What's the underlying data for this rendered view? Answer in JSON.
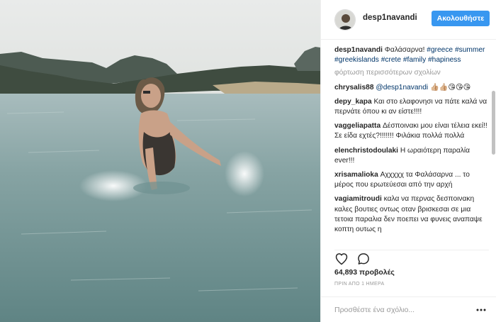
{
  "header": {
    "username": "desp1navandi",
    "follow_label": "Ακολουθήστε"
  },
  "caption": {
    "username": "desp1navandi",
    "text": "Φαλάσαρνα!",
    "hashtags": [
      "#greece",
      "#summer",
      "#greekislands",
      "#crete",
      "#family",
      "#hapiness"
    ]
  },
  "load_more_label": "φόρτωση περισσότερων σχολίων",
  "comments": [
    {
      "user": "chrysalis88",
      "mention": "@desp1navandi",
      "text": "👍🏼👍🏼😘😘😘"
    },
    {
      "user": "depy_kapa",
      "mention": "",
      "text": "Και στο ελαφονησι να πάτε καλά να περνάτε όπου κι αν είστε!!!!"
    },
    {
      "user": "vaggeliapatta",
      "mention": "",
      "text": "Δέσποινακι μου είναι τέλεια εκεί!! Σε είδα εχτές?!!!!!!! Φιλάκια πολλά πολλά"
    },
    {
      "user": "elenchristodoulaki",
      "mention": "",
      "text": "Η ωραιότερη παραλία ever!!!"
    },
    {
      "user": "xrisamalioka",
      "mention": "",
      "text": "Αχχχχχ τα Φαλάσαρνα ... το μέρος που ερωτεύεσαι από την αρχή"
    },
    {
      "user": "vagiamitroudi",
      "mention": "",
      "text": "καλα να περνας δεσποινακη καλες βουτιες οντως οταν βρισκεσαι σε μια τετοια παραλια δεν ποεπει να φυνεις αναπαψε κοπτη ουτως η"
    }
  ],
  "likes_text": "64,893 προβολές",
  "time_text": "ΠΡΙΝ ΑΠΟ 1 ΗΜΕΡΑ",
  "add_comment_placeholder": "Προσθέστε ένα σχόλιο...",
  "icons": {
    "like": "heart-icon",
    "comment": "speech-bubble-icon",
    "more": "more-options-icon"
  },
  "colors": {
    "follow_button": "#3897f0",
    "hashtag": "#003569",
    "muted": "#999999",
    "text": "#262626"
  }
}
